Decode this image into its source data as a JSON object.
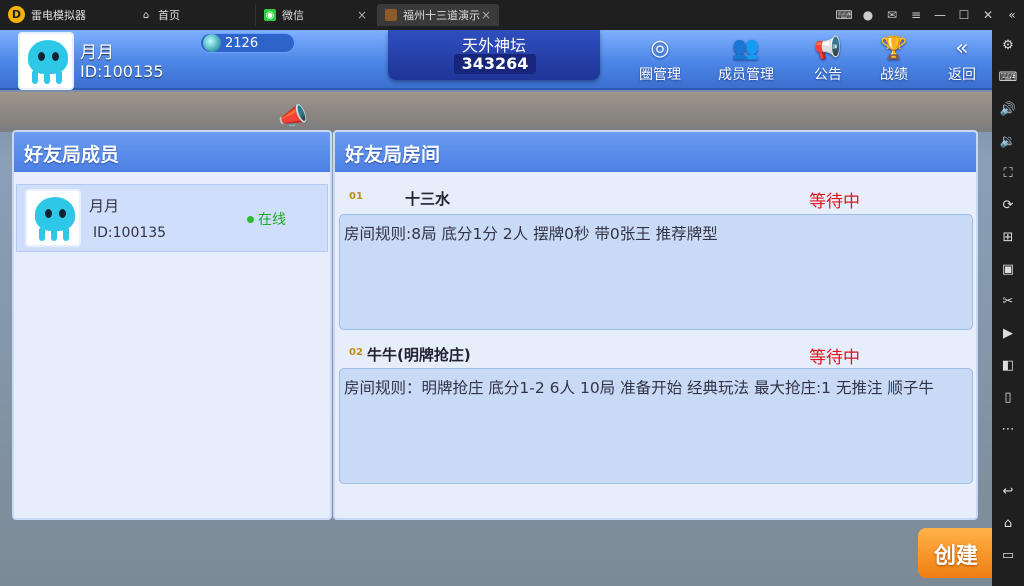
{
  "emulator": {
    "app_name": "雷电模拟器",
    "tabs": [
      {
        "label": "首页",
        "icon": "home-icon"
      },
      {
        "label": "微信",
        "icon": "wechat-icon"
      },
      {
        "label": "福州十三道演示",
        "icon": "game-icon"
      }
    ],
    "close_glyph": "×",
    "window_controls": [
      {
        "name": "gamepad-icon",
        "glyph": "⌨"
      },
      {
        "name": "account-icon",
        "glyph": "●"
      },
      {
        "name": "mail-icon",
        "glyph": "✉"
      },
      {
        "name": "menu-icon",
        "glyph": "≡"
      },
      {
        "name": "minimize-icon",
        "glyph": "—"
      },
      {
        "name": "maximize-icon",
        "glyph": "☐"
      },
      {
        "name": "close-window-icon",
        "glyph": "✕"
      },
      {
        "name": "collapse-icon",
        "glyph": "«"
      }
    ],
    "sidebar_icons": [
      {
        "name": "settings-icon",
        "glyph": "⚙"
      },
      {
        "name": "keyboard-icon",
        "glyph": "⌨"
      },
      {
        "name": "volume-up-icon",
        "glyph": "🔊"
      },
      {
        "name": "volume-down-icon",
        "glyph": "🔉"
      },
      {
        "name": "fullscreen-icon",
        "glyph": "⛶"
      },
      {
        "name": "sync-icon",
        "glyph": "⟳"
      },
      {
        "name": "add-app-icon",
        "glyph": "⊞"
      },
      {
        "name": "apk-icon",
        "glyph": "▣"
      },
      {
        "name": "scissors-icon",
        "glyph": "✂"
      },
      {
        "name": "record-icon",
        "glyph": "▶"
      },
      {
        "name": "video-icon",
        "glyph": "◧"
      },
      {
        "name": "shake-icon",
        "glyph": "▯"
      },
      {
        "name": "more-icon",
        "glyph": "⋯"
      },
      {
        "name": "back-icon",
        "glyph": "↩"
      },
      {
        "name": "home-nav-icon",
        "glyph": "⌂"
      },
      {
        "name": "recent-apps-icon",
        "glyph": "▭"
      }
    ]
  },
  "header": {
    "user_name": "月月",
    "user_id": "ID:100135",
    "coins": "2126",
    "club_name": "天外神坛",
    "club_number": "343264",
    "buttons": [
      {
        "label": "圈管理",
        "icon": "target-icon",
        "glyph": "◎"
      },
      {
        "label": "成员管理",
        "icon": "members-icon",
        "glyph": "👥"
      },
      {
        "label": "公告",
        "icon": "megaphone-icon",
        "glyph": "📢"
      },
      {
        "label": "战绩",
        "icon": "trophy-icon",
        "glyph": "🏆"
      },
      {
        "label": "返回",
        "icon": "back-arrow-icon",
        "glyph": "«"
      }
    ]
  },
  "members_panel": {
    "title": "好友局成员",
    "members": [
      {
        "name": "月月",
        "id": "ID:100135",
        "status": "在线"
      }
    ]
  },
  "rooms_panel": {
    "title": "好友局房间",
    "rooms": [
      {
        "number": "01",
        "name": "十三水",
        "status": "等待中",
        "rules": "房间规则:8局 底分1分 2人 摆牌0秒 带0张王 推荐牌型"
      },
      {
        "number": "02",
        "name": "牛牛(明牌抢庄)",
        "status": "等待中",
        "rules": "房间规则：明牌抢庄 底分1-2 6人 10局 准备开始 经典玩法 最大抢庄:1 无推注 顺子牛"
      }
    ]
  },
  "create_button": "创建",
  "colors": {
    "accent": "#4b7fe3",
    "status_waiting": "#e8101a",
    "online": "#1fa82a"
  }
}
